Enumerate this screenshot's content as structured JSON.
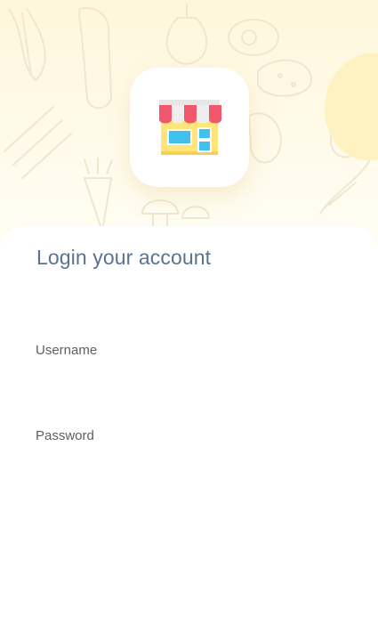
{
  "login": {
    "title": "Login your account",
    "username": {
      "label": "Username",
      "value": "",
      "placeholder": ""
    },
    "password": {
      "label": "Password",
      "value": "",
      "placeholder": ""
    }
  },
  "logo": {
    "icon": "storefront-icon"
  },
  "colors": {
    "title": "#5a7391",
    "label": "#5f5f5f",
    "hero_background": "#fff7dc",
    "awning_red": "#f0566c",
    "awning_white": "#e6e6e6",
    "shop_yellow": "#ffe57a",
    "window_blue": "#3fc1ec"
  }
}
